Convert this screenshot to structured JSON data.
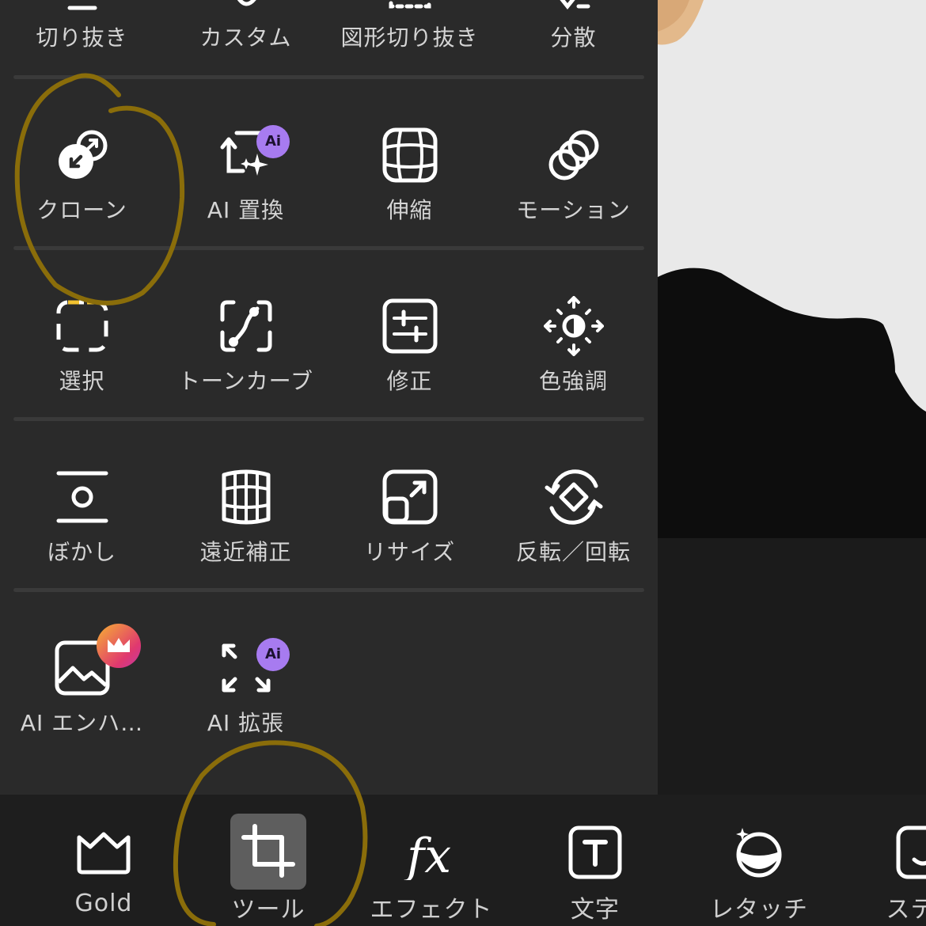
{
  "top_row": [
    {
      "label": "切り抜き",
      "icon": "cutout-icon"
    },
    {
      "label": "カスタム",
      "icon": "custom-icon"
    },
    {
      "label": "図形切り抜き",
      "icon": "shape-cutout-icon"
    },
    {
      "label": "分散",
      "icon": "disperse-icon"
    }
  ],
  "rows": [
    [
      {
        "label": "クローン",
        "icon": "clone-icon"
      },
      {
        "label": "AI 置換",
        "icon": "ai-replace-icon",
        "badge": "Ai"
      },
      {
        "label": "伸縮",
        "icon": "stretch-icon"
      },
      {
        "label": "モーション",
        "icon": "motion-icon"
      }
    ],
    [
      {
        "label": "選択",
        "icon": "select-icon"
      },
      {
        "label": "トーンカーブ",
        "icon": "tone-curve-icon"
      },
      {
        "label": "修正",
        "icon": "adjust-icon"
      },
      {
        "label": "色強調",
        "icon": "color-enhance-icon"
      }
    ],
    [
      {
        "label": "ぼかし",
        "icon": "blur-icon"
      },
      {
        "label": "遠近補正",
        "icon": "perspective-icon"
      },
      {
        "label": "リサイズ",
        "icon": "resize-icon"
      },
      {
        "label": "反転／回転",
        "icon": "flip-rotate-icon"
      }
    ],
    [
      {
        "label": "AI エンハ…",
        "icon": "ai-enhance-icon",
        "badge": "crown"
      },
      {
        "label": "AI 拡張",
        "icon": "ai-expand-icon",
        "badge": "Ai"
      }
    ]
  ],
  "bottom_tabs": [
    {
      "label": "Gold",
      "icon": "crown-icon"
    },
    {
      "label": "ツール",
      "icon": "crop-icon",
      "active": true
    },
    {
      "label": "エフェクト",
      "icon": "fx-icon"
    },
    {
      "label": "文字",
      "icon": "text-icon"
    },
    {
      "label": "レタッチ",
      "icon": "retouch-icon"
    },
    {
      "label": "ステッ",
      "icon": "sticker-icon"
    }
  ],
  "colors": {
    "accent_annotation": "#8a6d0a",
    "ai_badge": "#a77bf0",
    "panel": "#2a2a2a"
  }
}
